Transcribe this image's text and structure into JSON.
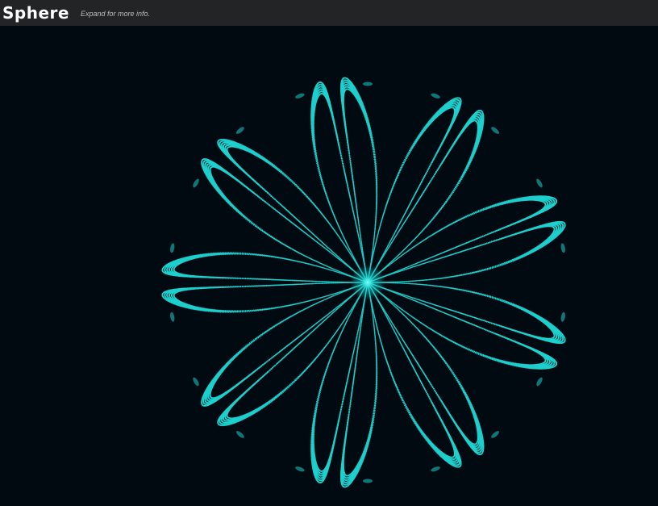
{
  "header": {
    "title": "Sphere",
    "subtitle": "Expand for more info."
  },
  "visual": {
    "petal_count": 18,
    "dot_color": "#1ed1cf",
    "center_glow_color": "#6ffff6",
    "background_color": "#010a10",
    "bar_color": "#222426"
  }
}
